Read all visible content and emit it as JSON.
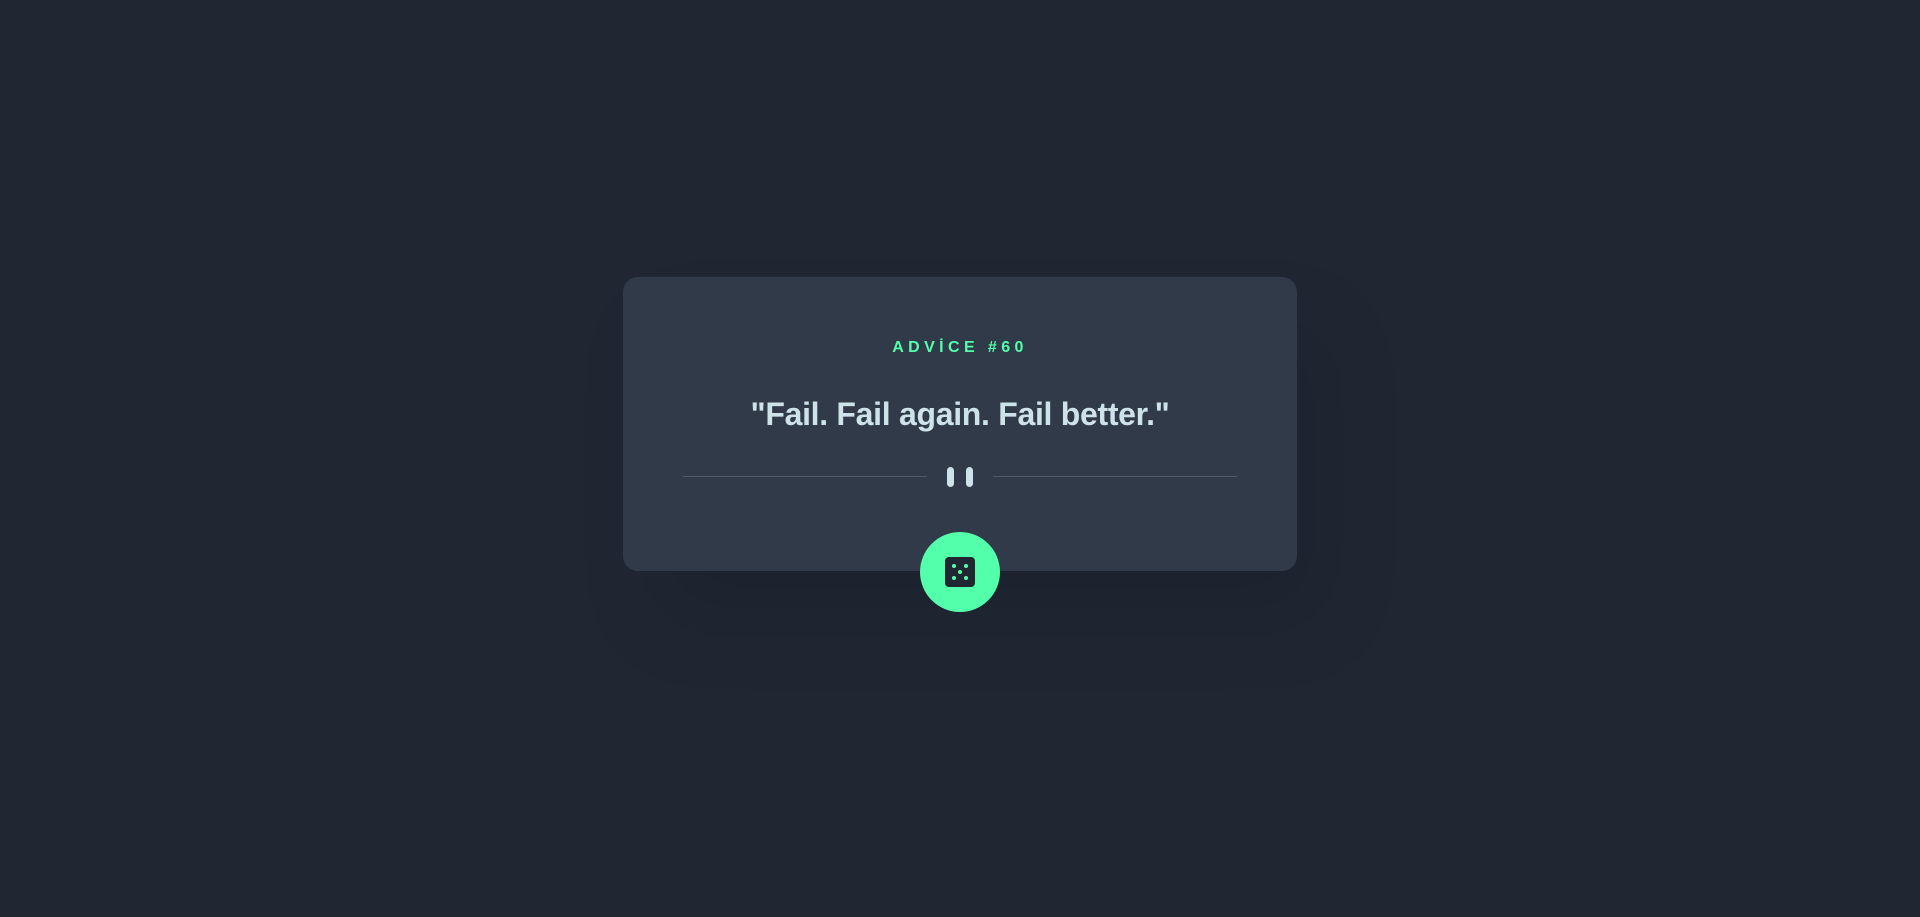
{
  "advice": {
    "label": "ADVİCE #60",
    "quote": "\"Fail. Fail again. Fail better.\""
  },
  "icons": {
    "divider": "pause-icon",
    "button": "dice-icon"
  },
  "colors": {
    "background": "#202733",
    "card": "#313a48",
    "accent": "#53ffaa",
    "text": "#cee3e9",
    "divider": "#4f5b6b"
  }
}
